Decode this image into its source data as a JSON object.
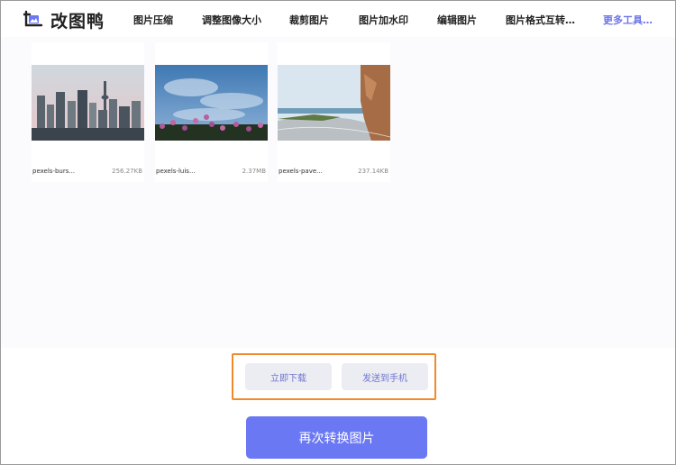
{
  "app": {
    "name": "改图鸭",
    "accent_color": "#6b78f4",
    "highlight_color": "#f08a28"
  },
  "nav": {
    "items": [
      {
        "label": "图片压缩"
      },
      {
        "label": "调整图像大小"
      },
      {
        "label": "裁剪图片"
      },
      {
        "label": "图片加水印"
      },
      {
        "label": "编辑图片"
      },
      {
        "label": "图片格式互转…"
      },
      {
        "label": "更多工具…"
      }
    ]
  },
  "files": [
    {
      "name": "pexels-burs...",
      "size": "256.27KB",
      "thumb": "city-skyline"
    },
    {
      "name": "pexels-luis...",
      "size": "2.37MB",
      "thumb": "flowers-sky"
    },
    {
      "name": "pexels-pave...",
      "size": "237.14KB",
      "thumb": "coastal-road"
    }
  ],
  "actions": {
    "download_label": "立即下载",
    "send_phone_label": "发送到手机",
    "convert_again_label": "再次转换图片"
  }
}
